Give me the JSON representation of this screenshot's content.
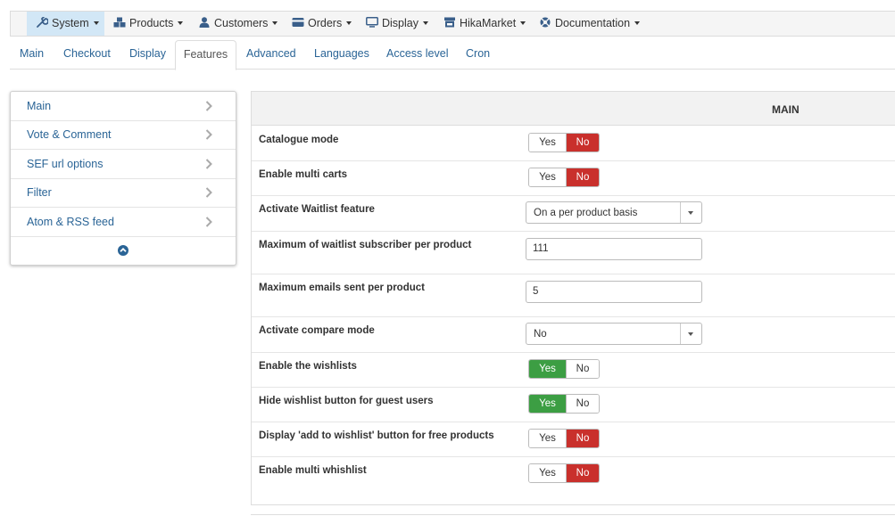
{
  "menu": {
    "items": [
      {
        "label": "System",
        "icon": "wrench-icon",
        "active": true
      },
      {
        "label": "Products",
        "icon": "cubes-icon"
      },
      {
        "label": "Customers",
        "icon": "user-icon"
      },
      {
        "label": "Orders",
        "icon": "credit-card-icon"
      },
      {
        "label": "Display",
        "icon": "monitor-icon"
      },
      {
        "label": "HikaMarket",
        "icon": "store-icon"
      },
      {
        "label": "Documentation",
        "icon": "lifebuoy-icon"
      }
    ]
  },
  "tabs": [
    "Main",
    "Checkout",
    "Display",
    "Features",
    "Advanced",
    "Languages",
    "Access level",
    "Cron"
  ],
  "active_tab": "Features",
  "sidebar": {
    "items": [
      "Main",
      "Vote & Comment",
      "SEF url options",
      "Filter",
      "Atom & RSS feed"
    ],
    "collapse_icon": "chevron-up-circle-icon"
  },
  "main": {
    "title": "MAIN",
    "yes_label": "Yes",
    "no_label": "No",
    "rows": [
      {
        "label": "Catalogue mode",
        "type": "toggle",
        "value": "No"
      },
      {
        "label": "Enable multi carts",
        "type": "toggle",
        "value": "No"
      },
      {
        "label": "Activate Waitlist feature",
        "type": "select",
        "value": "On a per product basis"
      },
      {
        "label": "Maximum of waitlist subscriber per product",
        "type": "text",
        "value": "111"
      },
      {
        "label": "Maximum emails sent per product",
        "type": "text",
        "value": "5"
      },
      {
        "label": "Activate compare mode",
        "type": "select",
        "value": "No"
      },
      {
        "label": "Enable the wishlists",
        "type": "toggle",
        "value": "Yes"
      },
      {
        "label": "Hide wishlist button for guest users",
        "type": "toggle",
        "value": "Yes"
      },
      {
        "label": "Display 'add to wishlist' button for free products",
        "type": "toggle",
        "value": "No"
      },
      {
        "label": "Enable multi whishlist",
        "type": "toggle",
        "value": "No"
      }
    ]
  },
  "colors": {
    "yes_active": "#3c9e43",
    "no_active": "#c9302c",
    "link": "#2a6496",
    "menu_active": "#d2e7f6"
  }
}
